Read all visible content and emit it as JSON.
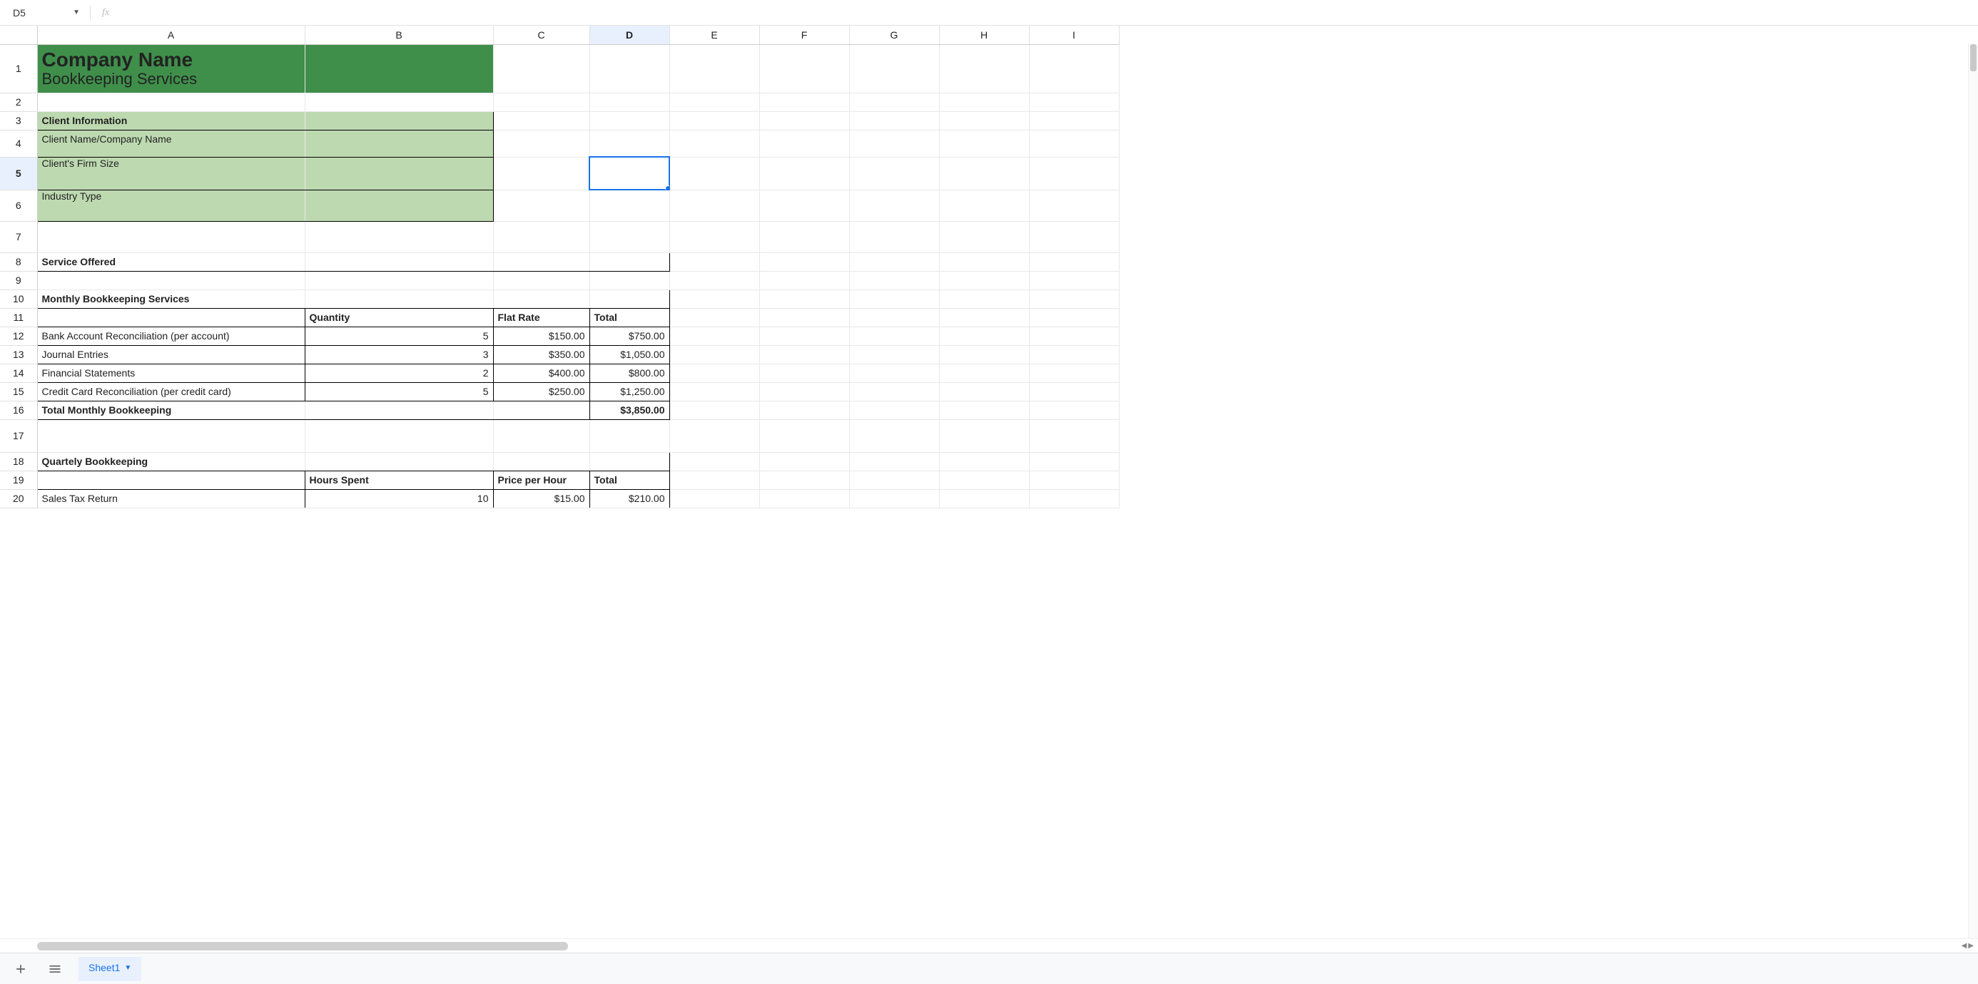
{
  "nameBox": "D5",
  "formula": "",
  "columns": [
    "A",
    "B",
    "C",
    "D",
    "E",
    "F",
    "G",
    "H",
    "I"
  ],
  "activeCell": {
    "col": "D",
    "row": 5
  },
  "header": {
    "title": "Company Name",
    "subtitle": "Bookkeeping Services"
  },
  "clientInfo": {
    "heading": "Client Information",
    "rows": [
      "Client Name/Company Name",
      "Client's Firm Size",
      "Industry Type"
    ]
  },
  "serviceOffered": "Service Offered",
  "monthly": {
    "heading": "Monthly Bookkeeping Services",
    "cols": {
      "qty": "Quantity",
      "rate": "Flat Rate",
      "total": "Total"
    },
    "rows": [
      {
        "label": "Bank Account Reconciliation (per account)",
        "qty": "5",
        "rate": "$150.00",
        "total": "$750.00"
      },
      {
        "label": "Journal Entries",
        "qty": "3",
        "rate": "$350.00",
        "total": "$1,050.00"
      },
      {
        "label": "Financial Statements",
        "qty": "2",
        "rate": "$400.00",
        "total": "$800.00"
      },
      {
        "label": "Credit Card Reconciliation (per credit card)",
        "qty": "5",
        "rate": "$250.00",
        "total": "$1,250.00"
      }
    ],
    "totalLabel": "Total Monthly Bookkeeping",
    "totalValue": "$3,850.00"
  },
  "quarterly": {
    "heading": "Quartely Bookkeeping",
    "cols": {
      "hours": "Hours Spent",
      "price": "Price per Hour",
      "total": "Total"
    },
    "rows": [
      {
        "label": "Sales Tax Return",
        "hours": "10",
        "price": "$15.00",
        "total": "$210.00"
      }
    ]
  },
  "sheetTab": "Sheet1"
}
